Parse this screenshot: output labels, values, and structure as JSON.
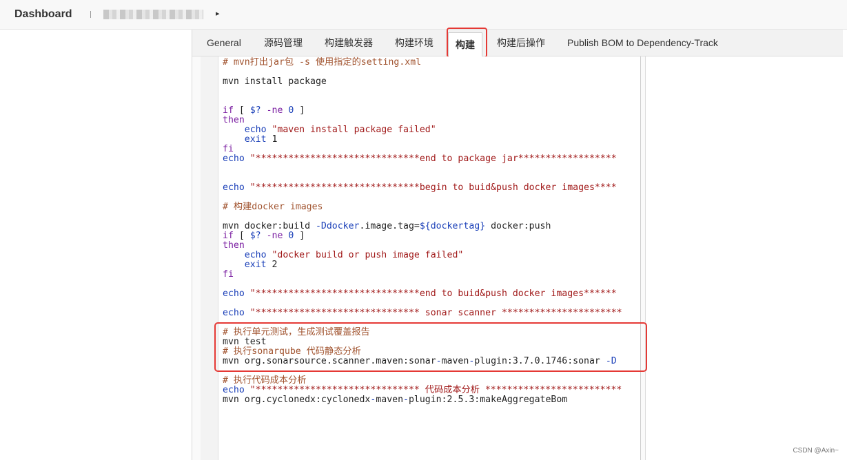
{
  "header": {
    "logo": "Dashboard",
    "breadcrumb_arrow": "▸"
  },
  "tabs": [
    {
      "label": "General"
    },
    {
      "label": "源码管理"
    },
    {
      "label": "构建触发器"
    },
    {
      "label": "构建环境"
    },
    {
      "label": "构建",
      "active": true
    },
    {
      "label": "构建后操作"
    },
    {
      "label": "Publish BOM to Dependency-Track"
    }
  ],
  "code_lines": [
    "# mvn打出jar包 -s 使用指定的setting.xml",
    "",
    "mvn install package",
    "",
    "",
    "if [ $? -ne 0 ]",
    "then",
    "    echo \"maven install package failed\"",
    "    exit 1",
    "fi",
    "echo \"******************************end to package jar******************",
    "",
    "",
    "echo \"******************************begin to buid&push docker images****",
    "",
    "# 构建docker images",
    "",
    "mvn docker:build -Ddocker.image.tag=${dockertag} docker:push",
    "if [ $? -ne 0 ]",
    "then",
    "    echo \"docker build or push image failed\"",
    "    exit 2",
    "fi",
    "",
    "echo \"******************************end to buid&push docker images******",
    "",
    "echo \"****************************** sonar scanner **********************",
    "",
    "# 执行单元测试，生成测试覆盖报告",
    "mvn test",
    "# 执行sonarqube 代码静态分析",
    "mvn org.sonarsource.scanner.maven:sonar-maven-plugin:3.7.0.1746:sonar -D",
    "",
    "# 执行代码成本分析",
    "echo \"****************************** 代码成本分析 *************************",
    "mvn org.cyclonedx:cyclonedx-maven-plugin:2.5.3:makeAggregateBom"
  ],
  "watermark": "CSDN @Axin~",
  "colors": {
    "highlight_border": "#e53935",
    "comment": "#a0522d",
    "keyword": "#7b1fa2",
    "builtin": "#1a3fb8",
    "string": "#a01818"
  }
}
